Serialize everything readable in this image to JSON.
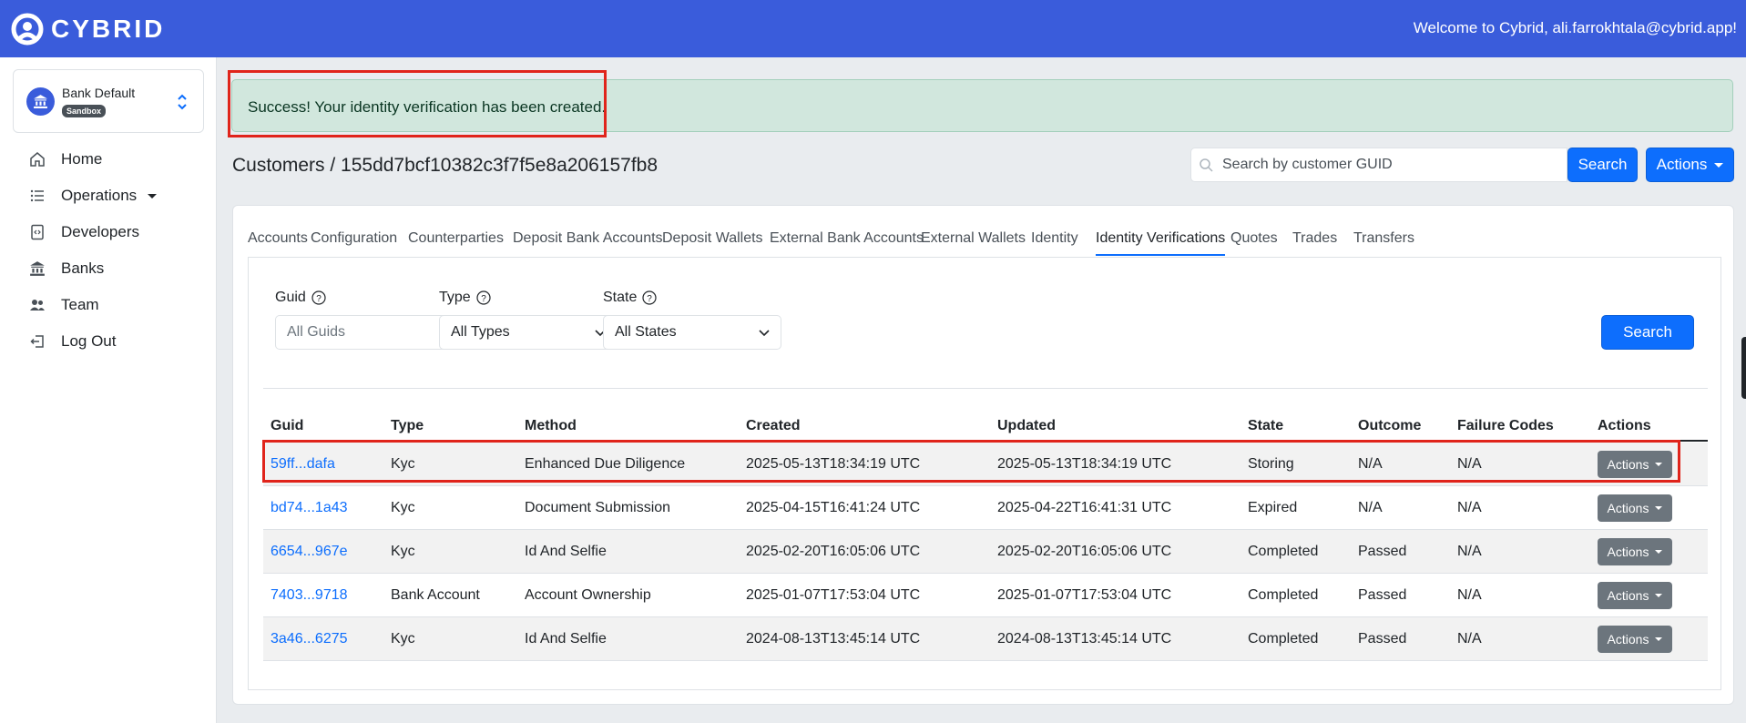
{
  "brand": {
    "name": "CYBRID"
  },
  "header": {
    "welcome": "Welcome to Cybrid, ali.farrokhtala@cybrid.app!"
  },
  "bank_selector": {
    "name": "Bank Default",
    "badge": "Sandbox"
  },
  "sidebar": {
    "items": [
      {
        "label": "Home",
        "icon": "home-icon"
      },
      {
        "label": "Operations",
        "icon": "list-icon"
      },
      {
        "label": "Developers",
        "icon": "code-file-icon"
      },
      {
        "label": "Banks",
        "icon": "bank-icon"
      },
      {
        "label": "Team",
        "icon": "people-icon"
      },
      {
        "label": "Log Out",
        "icon": "logout-icon"
      }
    ]
  },
  "alert": {
    "message": "Success! Your identity verification has been created."
  },
  "breadcrumb": "Customers / 155dd7bcf10382c3f7f5e8a206157fb8",
  "search": {
    "placeholder": "Search by customer GUID",
    "button": "Search"
  },
  "actions_button": "Actions",
  "tabs": [
    {
      "label": "Accounts"
    },
    {
      "label": "Configuration"
    },
    {
      "label": "Counterparties"
    },
    {
      "label": "Deposit Bank Accounts"
    },
    {
      "label": "Deposit Wallets"
    },
    {
      "label": "External Bank Accounts"
    },
    {
      "label": "External Wallets"
    },
    {
      "label": "Identity"
    },
    {
      "label": "Identity Verifications",
      "active": true
    },
    {
      "label": "Quotes"
    },
    {
      "label": "Trades"
    },
    {
      "label": "Transfers"
    }
  ],
  "filters": {
    "guid": {
      "label": "Guid",
      "placeholder": "All Guids"
    },
    "type": {
      "label": "Type",
      "value": "All Types"
    },
    "state": {
      "label": "State",
      "value": "All States"
    },
    "search_button": "Search"
  },
  "table": {
    "columns": [
      "Guid",
      "Type",
      "Method",
      "Created",
      "Updated",
      "State",
      "Outcome",
      "Failure Codes",
      "Actions"
    ],
    "rows": [
      {
        "guid": "59ff...dafa",
        "type": "Kyc",
        "method": "Enhanced Due Diligence",
        "created": "2025-05-13T18:34:19 UTC",
        "updated": "2025-05-13T18:34:19 UTC",
        "state": "Storing",
        "outcome": "N/A",
        "failure_codes": "N/A",
        "action": "Actions"
      },
      {
        "guid": "bd74...1a43",
        "type": "Kyc",
        "method": "Document Submission",
        "created": "2025-04-15T16:41:24 UTC",
        "updated": "2025-04-22T16:41:31 UTC",
        "state": "Expired",
        "outcome": "N/A",
        "failure_codes": "N/A",
        "action": "Actions"
      },
      {
        "guid": "6654...967e",
        "type": "Kyc",
        "method": "Id And Selfie",
        "created": "2025-02-20T16:05:06 UTC",
        "updated": "2025-02-20T16:05:06 UTC",
        "state": "Completed",
        "outcome": "Passed",
        "failure_codes": "N/A",
        "action": "Actions"
      },
      {
        "guid": "7403...9718",
        "type": "Bank Account",
        "method": "Account Ownership",
        "created": "2025-01-07T17:53:04 UTC",
        "updated": "2025-01-07T17:53:04 UTC",
        "state": "Completed",
        "outcome": "Passed",
        "failure_codes": "N/A",
        "action": "Actions"
      },
      {
        "guid": "3a46...6275",
        "type": "Kyc",
        "method": "Id And Selfie",
        "created": "2024-08-13T13:45:14 UTC",
        "updated": "2024-08-13T13:45:14 UTC",
        "state": "Completed",
        "outcome": "Passed",
        "failure_codes": "N/A",
        "action": "Actions"
      }
    ]
  },
  "colors": {
    "header": "#3a5cdb",
    "primary": "#0d6efd",
    "success_bg": "#d1e7dd",
    "highlight": "#e0241b"
  }
}
